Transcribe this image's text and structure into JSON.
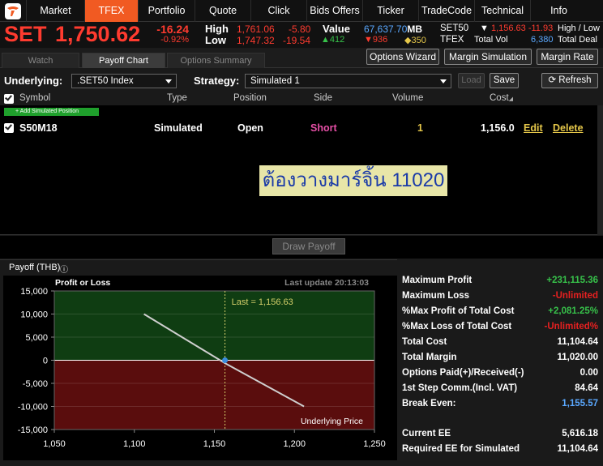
{
  "nav": {
    "tabs": [
      "Market",
      "TFEX",
      "Portfolio",
      "Quote",
      "Click",
      "Bids Offers",
      "Ticker",
      "TradeCode",
      "Technical",
      "Info"
    ],
    "active": "TFEX"
  },
  "quote": {
    "index_name": "SET",
    "index_value": "1,750.62",
    "change": "-16.24",
    "change_pct": "-0.92%",
    "high_label": "High",
    "high_value": "1,761.06",
    "high_change": "-5.80",
    "low_label": "Low",
    "low_value": "1,747.32",
    "low_change": "-19.54",
    "value_label": "Value",
    "value_amount": "67,637.70",
    "value_unit": "MB",
    "adv": "412",
    "dec": "936",
    "unch": "350",
    "set50_label": "SET50",
    "set50_value": "1,156.63",
    "set50_change": "-11.93",
    "hl_label": "High / Low",
    "tfex_label": "TFEX",
    "total_vol_label": "Total Vol",
    "total_vol": "6,380",
    "total_deal_label": "Total Deal"
  },
  "subtabs": [
    "Watch",
    "Payoff Chart",
    "Options Summary"
  ],
  "toolbar": {
    "options_wizard": "Options Wizard",
    "margin_simulation": "Margin Simulation",
    "margin_rate": "Margin Rate"
  },
  "form": {
    "underlying_label": "Underlying:",
    "underlying_value": ".SET50 Index",
    "strategy_label": "Strategy:",
    "strategy_value": "Simulated 1",
    "load": "Load",
    "save": "Save",
    "refresh": "Refresh"
  },
  "table": {
    "headers": [
      "Symbol",
      "Type",
      "Position",
      "Side",
      "Volume",
      "Cost"
    ],
    "add_position": "+ Add Simulated Position",
    "rows": [
      {
        "symbol": "S50M18",
        "type": "Simulated",
        "position": "Open",
        "side": "Short",
        "volume": "1",
        "cost": "1,156.0",
        "edit": "Edit",
        "delete": "Delete"
      }
    ]
  },
  "overlay_text": "ต้องวางมาร์จิ้น 11020",
  "draw_payoff": "Draw Payoff",
  "payoff_title": "Payoff (THB)",
  "chart_data": {
    "type": "line",
    "title": "Profit or Loss",
    "last_update": "Last update 20:13:03",
    "xlabel": "Underlying Price",
    "xlim": [
      1050,
      1250
    ],
    "ylim": [
      -15000,
      15000
    ],
    "xticks": [
      "1,050",
      "1,100",
      "1,150",
      "1,200",
      "1,250"
    ],
    "yticks": [
      "15,000",
      "10,000",
      "5,000",
      "0",
      "-5,000",
      "-10,000",
      "-15,000"
    ],
    "series": [
      {
        "x": [
          1106,
          1156.63,
          1206
        ],
        "y": [
          10000,
          -630,
          -10000
        ]
      }
    ],
    "last_marker": {
      "x": 1156.63,
      "y": 0,
      "label": "Last = 1,156.63"
    },
    "colors": {
      "profit_bg": "#0f3d12",
      "loss_bg": "#5a0d0d",
      "line": "#cfcfcf",
      "marker": "#3b8ede",
      "last_line": "#d4cf6a"
    }
  },
  "stats": [
    {
      "label": "Maximum Profit",
      "value": "+231,115.36",
      "color": "#37c14a"
    },
    {
      "label": "Maximum Loss",
      "value": "-Unlimited",
      "color": "#e62020"
    },
    {
      "label": "%Max Profit of Total Cost",
      "value": "+2,081.25%",
      "color": "#37c14a"
    },
    {
      "label": "%Max Loss of Total Cost",
      "value": "-Unlimited%",
      "color": "#e62020"
    },
    {
      "label": "Total Cost",
      "value": "11,104.64",
      "color": "#ffffff"
    },
    {
      "label": "Total Margin",
      "value": "11,020.00",
      "color": "#ffffff"
    },
    {
      "label": "Options Paid(+)/Received(-)",
      "value": "0.00",
      "color": "#ffffff"
    },
    {
      "label": "1st Step Comm.(Incl. VAT)",
      "value": "84.64",
      "color": "#ffffff"
    },
    {
      "label": "Break Even:",
      "value": "1,155.57",
      "color": "#5aa8ff"
    },
    {
      "label": "Current EE",
      "value": "5,616.18",
      "color": "#ffffff"
    },
    {
      "label": "Required EE for Simulated",
      "value": "11,104.64",
      "color": "#ffffff"
    }
  ]
}
